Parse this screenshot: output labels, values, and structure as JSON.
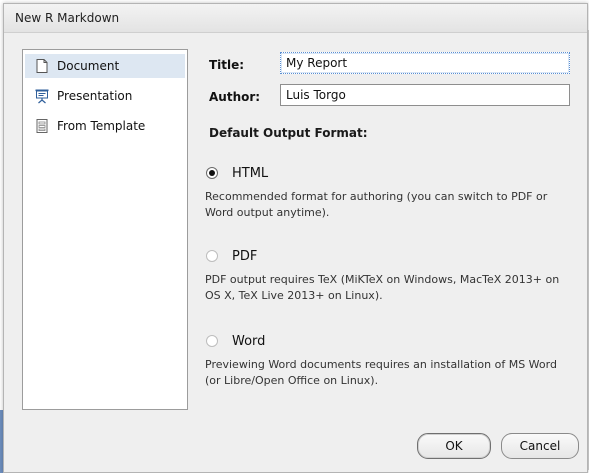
{
  "dialog": {
    "title": "New R Markdown"
  },
  "sidebar": {
    "items": [
      {
        "label": "Document",
        "icon": "document-icon",
        "selected": true
      },
      {
        "label": "Presentation",
        "icon": "presentation-icon",
        "selected": false
      },
      {
        "label": "From Template",
        "icon": "template-icon",
        "selected": false
      }
    ]
  },
  "form": {
    "title_label": "Title:",
    "title_value": "My Report",
    "author_label": "Author:",
    "author_value": "Luis Torgo"
  },
  "output": {
    "heading": "Default Output Format:",
    "selected": "HTML",
    "options": [
      {
        "label": "HTML",
        "checked": true,
        "desc": "Recommended format for authoring (you can switch to PDF or Word output anytime)."
      },
      {
        "label": "PDF",
        "checked": false,
        "desc": "PDF output requires TeX (MiKTeX on Windows, MacTeX 2013+ on OS X, TeX Live 2013+ on Linux)."
      },
      {
        "label": "Word",
        "checked": false,
        "desc": "Previewing Word documents requires an installation of MS Word (or Libre/Open Office on Linux)."
      }
    ]
  },
  "buttons": {
    "ok": "OK",
    "cancel": "Cancel"
  },
  "colors": {
    "selected_bg": "#dde7f2",
    "dialog_bg": "#efefef",
    "accent_icon": "#2f5f9b"
  }
}
